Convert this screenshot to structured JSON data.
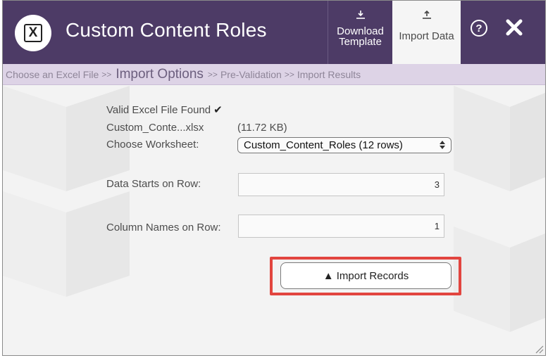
{
  "header": {
    "title": "Custom Content Roles",
    "app_icon": "excel-icon",
    "app_icon_letter": "X",
    "download_label_1": "Download",
    "download_label_2": "Template",
    "import_label": "Import Data",
    "help_glyph": "?",
    "colors": {
      "header_bg": "#4d3b66",
      "active_tab_bg": "#f5f5f5"
    }
  },
  "breadcrumb": {
    "step1": "Choose an Excel File",
    "step2": "Import Options",
    "step3": "Pre-Validation",
    "step4": "Import Results",
    "separator": ">>"
  },
  "form": {
    "valid_text": "Valid Excel File Found",
    "valid_check": "✔",
    "file_name": "Custom_Conte...xlsx",
    "file_size": "(11.72 KB)",
    "worksheet_label": "Choose Worksheet:",
    "worksheet_value": "Custom_Content_Roles (12 rows)",
    "data_row_label": "Data Starts on Row:",
    "data_row_value": "3",
    "col_names_label": "Column Names on Row:",
    "col_names_value": "1"
  },
  "actions": {
    "import_button": "▲ Import Records",
    "highlight_color": "#e2453f"
  }
}
